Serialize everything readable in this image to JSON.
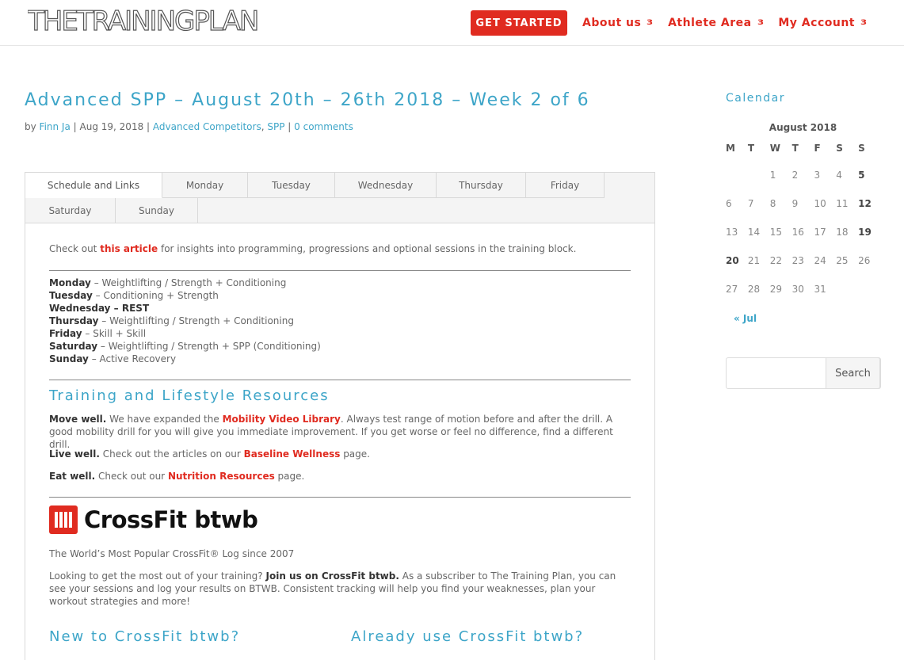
{
  "brand": {
    "logo_text": "THETRAININGPLAN"
  },
  "nav": {
    "cta_label": "GET STARTED",
    "items": [
      {
        "label": "About us"
      },
      {
        "label": "Athlete Area"
      },
      {
        "label": "My Account"
      }
    ],
    "chevron": "3"
  },
  "post": {
    "title": "Advanced SPP – August 20th – 26th 2018 – Week 2 of 6",
    "meta": {
      "by": "by",
      "author": "Finn Ja",
      "date": "Aug 19, 2018",
      "category_1": "Advanced Competitors",
      "category_2": "SPP",
      "comments": "0 comments",
      "sep": "|"
    }
  },
  "tabs": [
    "Schedule and Links",
    "Monday",
    "Tuesday",
    "Wednesday",
    "Thursday",
    "Friday",
    "Saturday",
    "Sunday"
  ],
  "content": {
    "intro_pre": "Check out ",
    "intro_link": "this article",
    "intro_post": " for insights into programming, progressions and optional sessions in the training block.",
    "schedule": [
      {
        "day": "Monday",
        "desc": " – Weightlifting / Strength + Conditioning"
      },
      {
        "day": "Tuesday",
        "desc": " – Conditioning + Strength"
      },
      {
        "day": "Wednesday – REST",
        "desc": ""
      },
      {
        "day": "Thursday",
        "desc": " – Weightlifting / Strength + Conditioning"
      },
      {
        "day": "Friday",
        "desc": " – Skill + Skill"
      },
      {
        "day": "Saturday",
        "desc": " – Weightlifting / Strength + SPP (Conditioning)"
      },
      {
        "day": "Sunday",
        "desc": " – Active Recovery"
      }
    ],
    "resources_title": "Training and Lifestyle Resources",
    "move": {
      "lead": "Move well.",
      "pre": " We have expanded the ",
      "link": "Mobility Video Library",
      "post": ". Always test range of motion before and after the drill. A good mobility drill for you will give you immediate improvement. If you get worse or feel no difference, find a different drill."
    },
    "live": {
      "lead": "Live well.",
      "pre": " Check out the articles on our ",
      "link": "Baseline Wellness",
      "post": " page."
    },
    "eat": {
      "lead": "Eat well.",
      "pre": " Check out our ",
      "link": "Nutrition Resources",
      "post": " page."
    },
    "btwb_logo_text": "CrossFit btwb",
    "btwb_tagline": "The World’s Most Popular CrossFit® Log since 2007",
    "btwb_pre": "Looking to get the most out of your training? ",
    "btwb_bold": "Join us on CrossFit btwb.",
    "btwb_post": " As a subscriber to The Training Plan, you can see your sessions and log your results on BTWB. Consistent tracking will help you find your weaknesses, plan your workout strategies and more!",
    "col_left_title": "New to CrossFit btwb?",
    "col_right_title": "Already use CrossFit btwb?"
  },
  "sidebar": {
    "calendar_title": "Calendar",
    "month": "August 2018",
    "weekdays": [
      "M",
      "T",
      "W",
      "T",
      "F",
      "S",
      "S"
    ],
    "weeks": [
      [
        "",
        "",
        "1",
        "2",
        "3",
        "4",
        "5"
      ],
      [
        "6",
        "7",
        "8",
        "9",
        "10",
        "11",
        "12"
      ],
      [
        "13",
        "14",
        "15",
        "16",
        "17",
        "18",
        "19"
      ],
      [
        "20",
        "21",
        "22",
        "23",
        "24",
        "25",
        "26"
      ],
      [
        "27",
        "28",
        "29",
        "30",
        "31",
        "",
        ""
      ]
    ],
    "bold_days": [
      "5",
      "12",
      "19",
      "20"
    ],
    "prev_link": "« Jul",
    "search_button": "Search",
    "search_placeholder": ""
  }
}
